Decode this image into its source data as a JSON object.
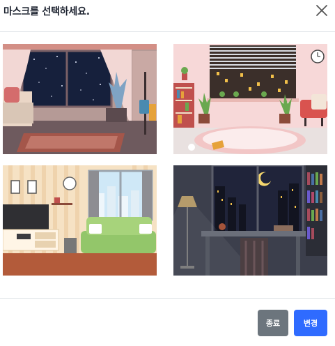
{
  "dialog": {
    "title": "마스크를 선택하세요."
  },
  "images": [
    {
      "id": "living-room-night",
      "icon": "living-room-night-image"
    },
    {
      "id": "kitchen-window",
      "icon": "kitchen-window-image"
    },
    {
      "id": "living-room-day",
      "icon": "living-room-day-image"
    },
    {
      "id": "study-room-night",
      "icon": "study-room-night-image"
    }
  ],
  "footer": {
    "close_label": "종료",
    "change_label": "변경"
  },
  "colors": {
    "primary": "#2f6bff",
    "secondary": "#6c757d",
    "divider": "#dee2e6"
  }
}
